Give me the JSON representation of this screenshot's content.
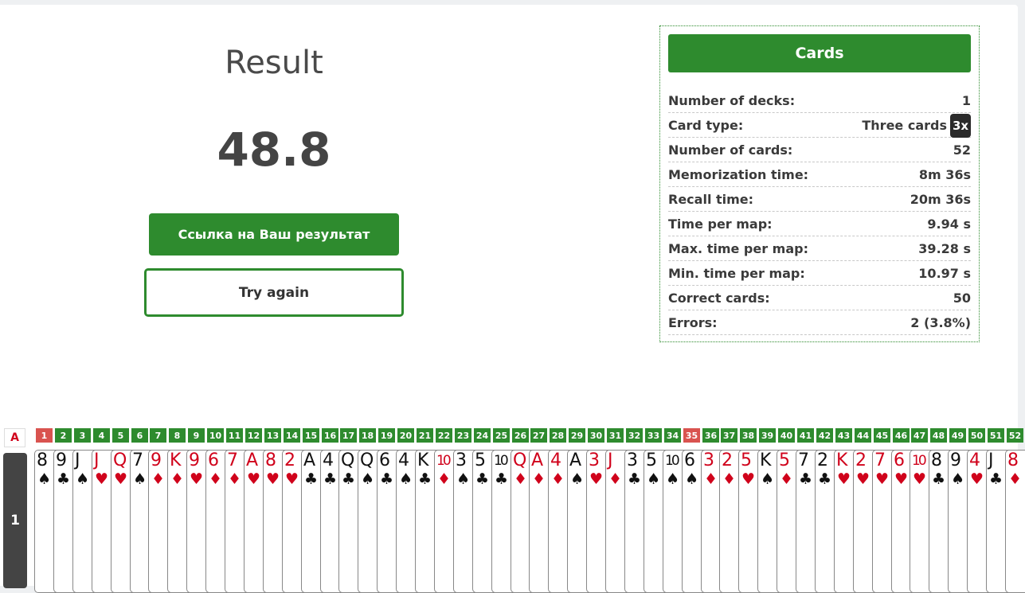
{
  "result": {
    "title": "Result",
    "score": "48.8",
    "link_label": "Ссылка на Ваш результат",
    "retry_label": "Try again"
  },
  "stats": {
    "header": "Cards",
    "rows": [
      {
        "label": "Number of decks:",
        "value": "1"
      },
      {
        "label": "Card type:",
        "value": "Three cards",
        "badge": "3x"
      },
      {
        "label": "Number of cards:",
        "value": "52"
      },
      {
        "label": "Memorization time:",
        "value": "8m 36s"
      },
      {
        "label": "Recall time:",
        "value": "20m 36s"
      },
      {
        "label": "Time per map:",
        "value": "9.94 s"
      },
      {
        "label": "Max. time per map:",
        "value": "39.28 s"
      },
      {
        "label": "Min. time per map:",
        "value": "10.97 s"
      },
      {
        "label": "Correct cards:",
        "value": "50"
      },
      {
        "label": "Errors:",
        "value": "2 (3.8%)"
      }
    ]
  },
  "grid": {
    "row_header": "A",
    "deck_label": "1",
    "error_positions": [
      1,
      35
    ],
    "cards": [
      {
        "rank": "8",
        "suit": "♠"
      },
      {
        "rank": "9",
        "suit": "♣"
      },
      {
        "rank": "J",
        "suit": "♠"
      },
      {
        "rank": "J",
        "suit": "♥"
      },
      {
        "rank": "Q",
        "suit": "♥"
      },
      {
        "rank": "7",
        "suit": "♠"
      },
      {
        "rank": "9",
        "suit": "♦"
      },
      {
        "rank": "K",
        "suit": "♦"
      },
      {
        "rank": "9",
        "suit": "♥"
      },
      {
        "rank": "6",
        "suit": "♦"
      },
      {
        "rank": "7",
        "suit": "♦"
      },
      {
        "rank": "A",
        "suit": "♥"
      },
      {
        "rank": "8",
        "suit": "♥"
      },
      {
        "rank": "2",
        "suit": "♥"
      },
      {
        "rank": "A",
        "suit": "♣"
      },
      {
        "rank": "4",
        "suit": "♣"
      },
      {
        "rank": "Q",
        "suit": "♣"
      },
      {
        "rank": "Q",
        "suit": "♠"
      },
      {
        "rank": "6",
        "suit": "♣"
      },
      {
        "rank": "4",
        "suit": "♠"
      },
      {
        "rank": "K",
        "suit": "♣"
      },
      {
        "rank": "10",
        "suit": "♦"
      },
      {
        "rank": "3",
        "suit": "♠"
      },
      {
        "rank": "5",
        "suit": "♣"
      },
      {
        "rank": "10",
        "suit": "♣"
      },
      {
        "rank": "Q",
        "suit": "♦"
      },
      {
        "rank": "A",
        "suit": "♦"
      },
      {
        "rank": "4",
        "suit": "♦"
      },
      {
        "rank": "A",
        "suit": "♠"
      },
      {
        "rank": "3",
        "suit": "♥"
      },
      {
        "rank": "J",
        "suit": "♦"
      },
      {
        "rank": "3",
        "suit": "♣"
      },
      {
        "rank": "5",
        "suit": "♠"
      },
      {
        "rank": "10",
        "suit": "♠"
      },
      {
        "rank": "6",
        "suit": "♠"
      },
      {
        "rank": "3",
        "suit": "♦"
      },
      {
        "rank": "2",
        "suit": "♦"
      },
      {
        "rank": "5",
        "suit": "♥"
      },
      {
        "rank": "K",
        "suit": "♠"
      },
      {
        "rank": "5",
        "suit": "♦"
      },
      {
        "rank": "7",
        "suit": "♣"
      },
      {
        "rank": "2",
        "suit": "♣"
      },
      {
        "rank": "K",
        "suit": "♥"
      },
      {
        "rank": "2",
        "suit": "♥"
      },
      {
        "rank": "7",
        "suit": "♥"
      },
      {
        "rank": "6",
        "suit": "♥"
      },
      {
        "rank": "10",
        "suit": "♥"
      },
      {
        "rank": "8",
        "suit": "♣"
      },
      {
        "rank": "9",
        "suit": "♠"
      },
      {
        "rank": "4",
        "suit": "♥"
      },
      {
        "rank": "J",
        "suit": "♣"
      },
      {
        "rank": "8",
        "suit": "♦"
      }
    ]
  }
}
